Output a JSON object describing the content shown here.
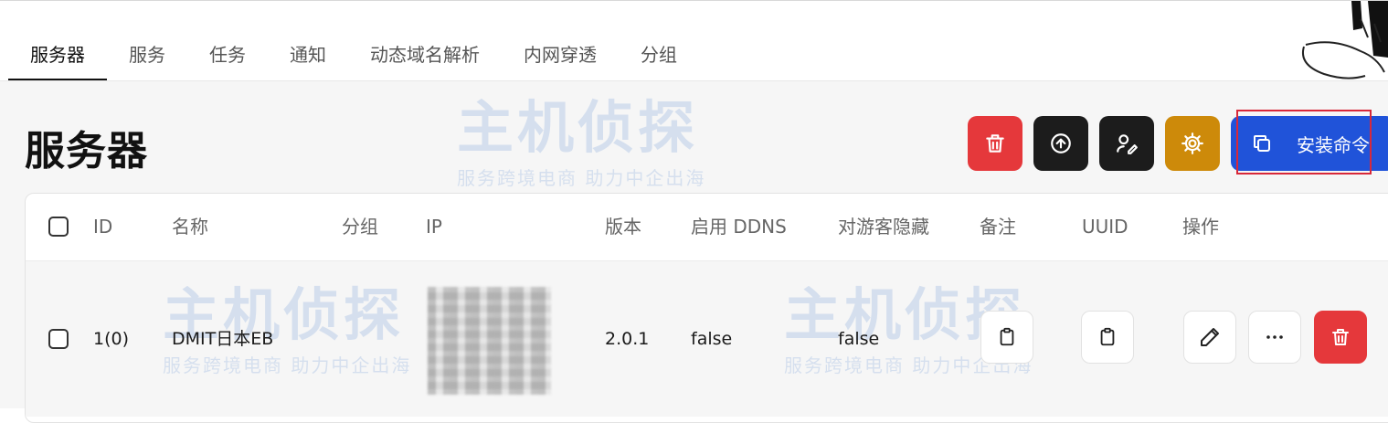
{
  "nav": {
    "tabs": [
      {
        "label": "服务器",
        "active": true
      },
      {
        "label": "服务"
      },
      {
        "label": "任务"
      },
      {
        "label": "通知"
      },
      {
        "label": "动态域名解析"
      },
      {
        "label": "内网穿透"
      },
      {
        "label": "分组"
      }
    ]
  },
  "page": {
    "title": "服务器"
  },
  "toolbar": {
    "delete_icon": "trash-icon",
    "upgrade_icon": "arrow-up-circle-icon",
    "assign_icon": "user-edit-icon",
    "settings_icon": "gear-icon",
    "install_label": "安装命令",
    "install_icon": "copy-icon",
    "colors": {
      "danger": "#e5383b",
      "dark": "#1c1c1c",
      "gold": "#cd8a0a",
      "primary": "#2053d9"
    }
  },
  "table": {
    "headers": [
      "ID",
      "名称",
      "分组",
      "IP",
      "版本",
      "启用 DDNS",
      "对游客隐藏",
      "备注",
      "UUID",
      "操作"
    ],
    "rows": [
      {
        "id": "1(0)",
        "name": "DMIT日本EB",
        "group": "",
        "version": "2.0.1",
        "ddns": "false",
        "hide_guest": "false"
      }
    ]
  },
  "watermark": {
    "brand": "主机侦探",
    "slogan": "服务跨境电商 助力中企出海"
  }
}
